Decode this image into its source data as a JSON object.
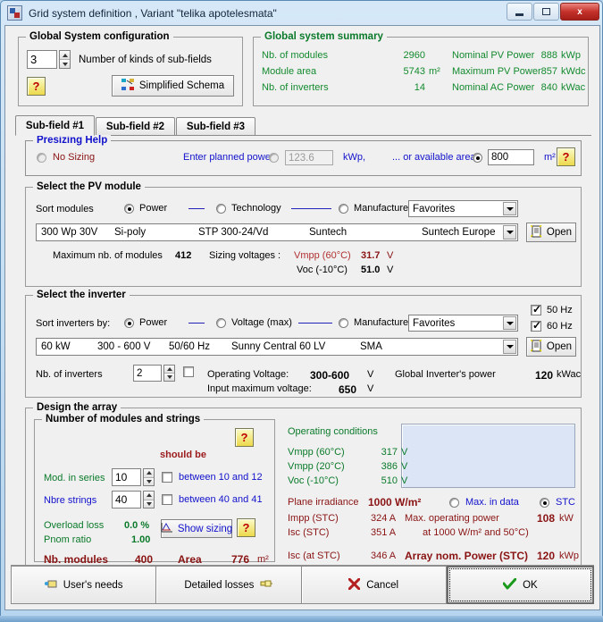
{
  "window": {
    "title": "Grid system definition , Variant   \"telika apotelesmata\"",
    "minimize_label": "Minimize",
    "maximize_label": "Maximize",
    "close_label": "x"
  },
  "global_config": {
    "legend": "Global System configuration",
    "subfield_count": "3",
    "subfield_label": "Number of kinds of sub-fields",
    "help_label": "?",
    "schema_button": "Simplified Schema"
  },
  "summary": {
    "legend": "Global system summary",
    "rows": [
      {
        "label": "Nb. of modules",
        "value": "2960",
        "unit": "",
        "label2": "Nominal PV Power",
        "value2": "888",
        "unit2": "kWp"
      },
      {
        "label": "Module area",
        "value": "5743",
        "unit": "m²",
        "label2": "Maximum PV Power",
        "value2": "857",
        "unit2": "kWdc"
      },
      {
        "label": "Nb. of inverters",
        "value": "14",
        "unit": "",
        "label2": "Nominal AC Power",
        "value2": "840",
        "unit2": "kWac"
      }
    ]
  },
  "tabs": [
    {
      "label": "Sub-field #1",
      "active": true
    },
    {
      "label": "Sub-field #2",
      "active": false
    },
    {
      "label": "Sub-field #3",
      "active": false
    }
  ],
  "presizing": {
    "legend": "Presizing Help",
    "no_sizing": "No Sizing",
    "planned_power_label": "Enter planned power",
    "planned_power_value": "123.6",
    "planned_power_unit": "kWp,",
    "available_area_label": "... or available area",
    "available_area_value": "800",
    "available_area_unit": "m²",
    "help_label": "?"
  },
  "pv_module": {
    "legend": "Select the PV module",
    "sort_label": "Sort modules",
    "sort_power": "Power",
    "sort_technology": "Technology",
    "sort_manufacturer": "Manufacturer",
    "filter_value": "Favorites",
    "module_power": "300 Wp 30V",
    "module_tech": "Si-poly",
    "module_model": "STP 300-24/Vd",
    "module_manufacturer": "Suntech",
    "module_supplier": "Suntech Europe",
    "open_label": "Open",
    "max_modules_label": "Maximum nb. of modules",
    "max_modules_value": "412",
    "sizing_voltages_label": "Sizing voltages :",
    "vmpp_label": "Vmpp (60°C)",
    "vmpp_value": "31.7",
    "vmpp_unit": "V",
    "voc_label": "Voc  (-10°C)",
    "voc_value": "51.0",
    "voc_unit": "V"
  },
  "inverter": {
    "legend": "Select the inverter",
    "sort_label": "Sort inverters by:",
    "sort_power": "Power",
    "sort_voltage": "Voltage (max)",
    "sort_manufacturer": "Manufacturer",
    "filter_value": "Favorites",
    "hz50": "50 Hz",
    "hz60": "60 Hz",
    "inv_power": "60 kW",
    "inv_voltage": "300 - 600 V",
    "inv_freq": "50/60 Hz",
    "inv_model": "Sunny Central 60  LV",
    "inv_manufacturer": "SMA",
    "open_label": "Open",
    "nb_inverters_label": "Nb. of inverters",
    "nb_inverters_value": "2",
    "operating_voltage_label": "Operating Voltage:",
    "operating_voltage_value": "300-600",
    "operating_voltage_unit": "V",
    "input_max_voltage_label": "Input maximum voltage:",
    "input_max_voltage_value": "650",
    "input_max_voltage_unit": "V",
    "global_power_label": "Global Inverter's power",
    "global_power_value": "120",
    "global_power_unit": "kWac"
  },
  "array": {
    "legend": "Design the array",
    "modules_legend": "Number of modules and strings",
    "help_label": "?",
    "should_be": "should be",
    "mod_series_label": "Mod. in series",
    "mod_series_value": "10",
    "mod_series_range": "between 10 and 12",
    "strings_label": "Nbre strings",
    "strings_value": "40",
    "strings_range": "between 40 and 41",
    "overload_label": "Overload loss",
    "overload_value": "0.0 %",
    "pnom_label": "Pnom ratio",
    "pnom_value": "1.00",
    "show_sizing": "Show sizing",
    "nb_modules_label": "Nb. modules",
    "nb_modules_value": "400",
    "area_label": "Area",
    "area_value": "776",
    "area_unit": "m²"
  },
  "conditions": {
    "title": "Operating conditions",
    "rows": [
      {
        "label": "Vmpp (60°C)",
        "value": "317",
        "unit": "V"
      },
      {
        "label": "Vmpp (20°C)",
        "value": "386",
        "unit": "V"
      },
      {
        "label": "Voc  (-10°C)",
        "value": "510",
        "unit": "V"
      }
    ],
    "plane_irradiance_label": "Plane irradiance",
    "plane_irradiance_value": "1000 W/m²",
    "max_in_data": "Max. in data",
    "stc": "STC",
    "impp_label": "Impp (STC)",
    "impp_value": "324 A",
    "max_op_power_label": "Max. operating power",
    "max_op_power_value": "108",
    "max_op_power_unit": "kW",
    "isc_label": "Isc  (STC)",
    "isc_value": "351 A",
    "at_conditions": "at 1000 W/m² and 50°C)",
    "isc_stc_label": "Isc (at STC)",
    "isc_stc_value": "346 A",
    "array_nom_label": "Array nom. Power (STC)",
    "array_nom_value": "120",
    "array_nom_unit": "kWp"
  },
  "footer": {
    "users_needs": "User's needs",
    "detailed_losses": "Detailed losses",
    "cancel": "Cancel",
    "ok": "OK"
  },
  "colors": {
    "green": "#138a2e",
    "maroon": "#8a1313",
    "blue": "#1111cc",
    "panel": "#f0f0f0",
    "bluepanel": "#dce5f5"
  }
}
